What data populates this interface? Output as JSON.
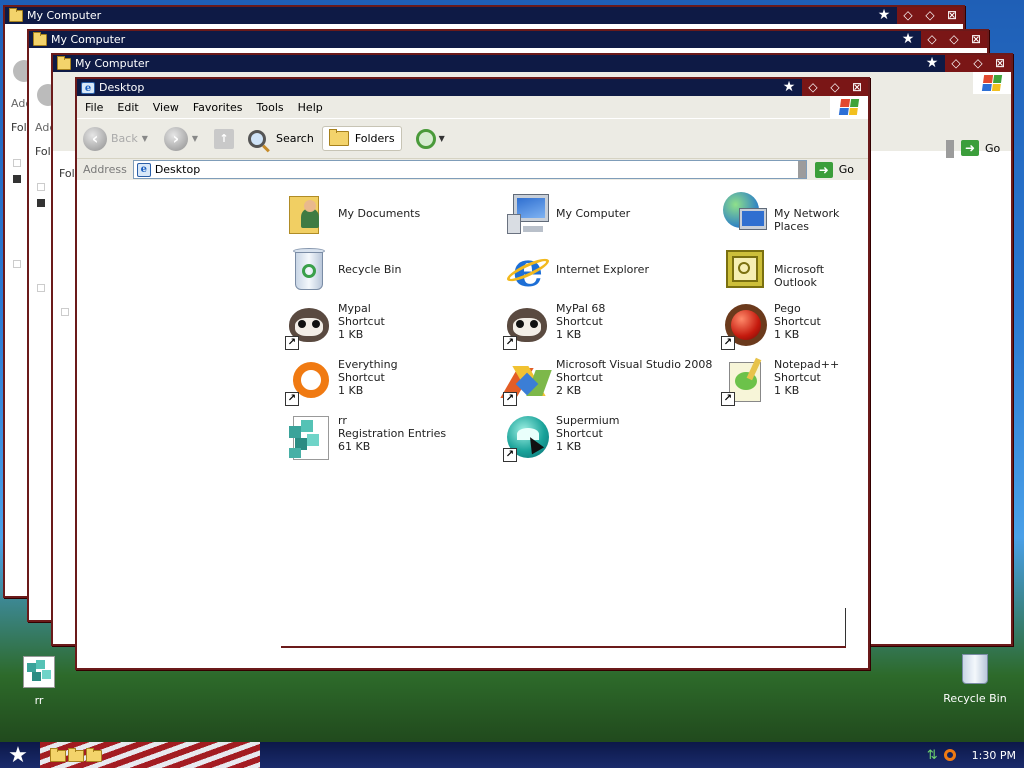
{
  "windows": [
    {
      "title": "My Computer",
      "fragment_address": "Add",
      "fragment_folders": "Fold"
    },
    {
      "title": "My Computer",
      "fragment_address": "Add",
      "fragment_folders": "Fold"
    },
    {
      "title": "My Computer",
      "fragment_address": "Add",
      "fragment_folders": "Fold"
    },
    {
      "title": "Desktop"
    }
  ],
  "titlebar_buttons": {
    "star": "★",
    "b1": "◇",
    "b2": "◇",
    "b3": "⊠"
  },
  "menu": [
    "File",
    "Edit",
    "View",
    "Favorites",
    "Tools",
    "Help"
  ],
  "toolbar": {
    "back_label": "Back",
    "search_label": "Search",
    "folders_label": "Folders"
  },
  "address": {
    "label": "Address",
    "value": "Desktop",
    "go_label": "Go"
  },
  "back_window_go": "Go",
  "items": [
    {
      "name": "My Documents",
      "type": "",
      "size": "",
      "icon": "my-documents-icon"
    },
    {
      "name": "My Computer",
      "type": "",
      "size": "",
      "icon": "my-computer-icon"
    },
    {
      "name": "My Network Places",
      "type": "",
      "size": "",
      "icon": "network-places-icon"
    },
    {
      "name": "Recycle Bin",
      "type": "",
      "size": "",
      "icon": "recycle-bin-icon"
    },
    {
      "name": "Internet Explorer",
      "type": "",
      "size": "",
      "icon": "internet-explorer-icon"
    },
    {
      "name": "Microsoft Outlook",
      "type": "",
      "size": "",
      "icon": "outlook-icon"
    },
    {
      "name": "Mypal",
      "type": "Shortcut",
      "size": "1 KB",
      "icon": "mypal-icon"
    },
    {
      "name": "MyPal 68",
      "type": "Shortcut",
      "size": "1 KB",
      "icon": "mypal68-icon"
    },
    {
      "name": "Pego",
      "type": "Shortcut",
      "size": "1 KB",
      "icon": "pego-icon"
    },
    {
      "name": "Everything",
      "type": "Shortcut",
      "size": "1 KB",
      "icon": "everything-icon"
    },
    {
      "name": "Microsoft Visual Studio 2008",
      "type": "Shortcut",
      "size": "2 KB",
      "icon": "visual-studio-icon"
    },
    {
      "name": "Notepad++",
      "type": "Shortcut",
      "size": "1 KB",
      "icon": "notepadpp-icon"
    },
    {
      "name": "rr",
      "type": "Registration Entries",
      "size": "61 KB",
      "icon": "registry-file-icon"
    },
    {
      "name": "Supermium",
      "type": "Shortcut",
      "size": "1 KB",
      "icon": "supermium-icon"
    }
  ],
  "desktop_icons": [
    {
      "label": "rr",
      "icon": "registry-file-icon"
    },
    {
      "label": "Recycle Bin",
      "icon": "recycle-bin-icon"
    }
  ],
  "taskbar": {
    "start_glyph": "★",
    "clock": "1:30 PM"
  },
  "colors": {
    "titlebar": "#0e1a45",
    "title_buttons": "#7a1616",
    "window_border": "#6b1a1a",
    "chrome": "#ecebe4"
  }
}
